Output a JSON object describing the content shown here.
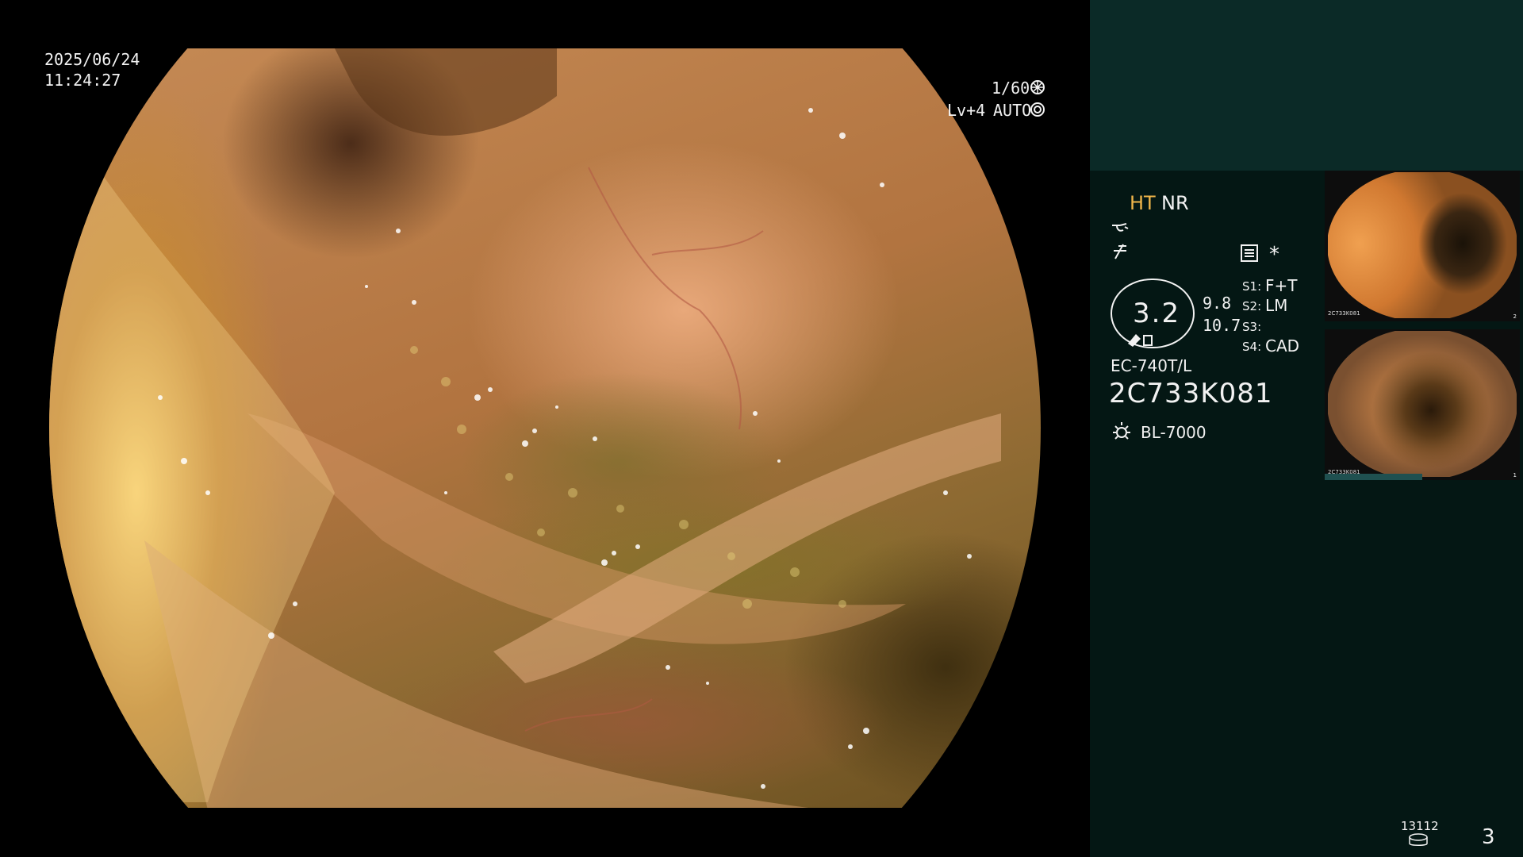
{
  "overlay": {
    "date": "2025/06/24",
    "time": "11:24:27",
    "shutter": "1/60",
    "shutter_icon": "shutter-icon",
    "level": "Lv+4",
    "exposure_mode": "AUTO",
    "exposure_icon": "auto-exposure-icon"
  },
  "panel": {
    "mode_ht": "HT",
    "mode_nr": "NR",
    "mode_icons": [
      "structure-enhance-icon",
      "noise-reduction-icon"
    ],
    "settings_icon": "settings-panel-icon",
    "star": "*",
    "gauge_value": "3.2",
    "gauge_icon": "zoom-gauge-icon",
    "value_top": "9.8",
    "value_bottom": "10.7",
    "switches": [
      {
        "label": "S1:",
        "value": "F+T"
      },
      {
        "label": "S2:",
        "value": "LM"
      },
      {
        "label": "S3:",
        "value": ""
      },
      {
        "label": "S4:",
        "value": "CAD"
      }
    ],
    "scope_model": "EC-740T/L",
    "scope_serial": "2C733K081",
    "light_icon": "light-source-icon",
    "light_source": "BL-7000",
    "record_count": "13112",
    "record_icon": "storage-icon",
    "page_number": "3"
  },
  "thumbnails": [
    {
      "name": "capture-1",
      "label": "2C733K081",
      "number": "2"
    },
    {
      "name": "capture-2",
      "label": "2C733K081",
      "number": "1"
    }
  ],
  "colors": {
    "panel_background": "#041714",
    "panel_header": "#0b2a27",
    "ht_accent": "#f0b64a",
    "text": "#f2f2f2"
  }
}
